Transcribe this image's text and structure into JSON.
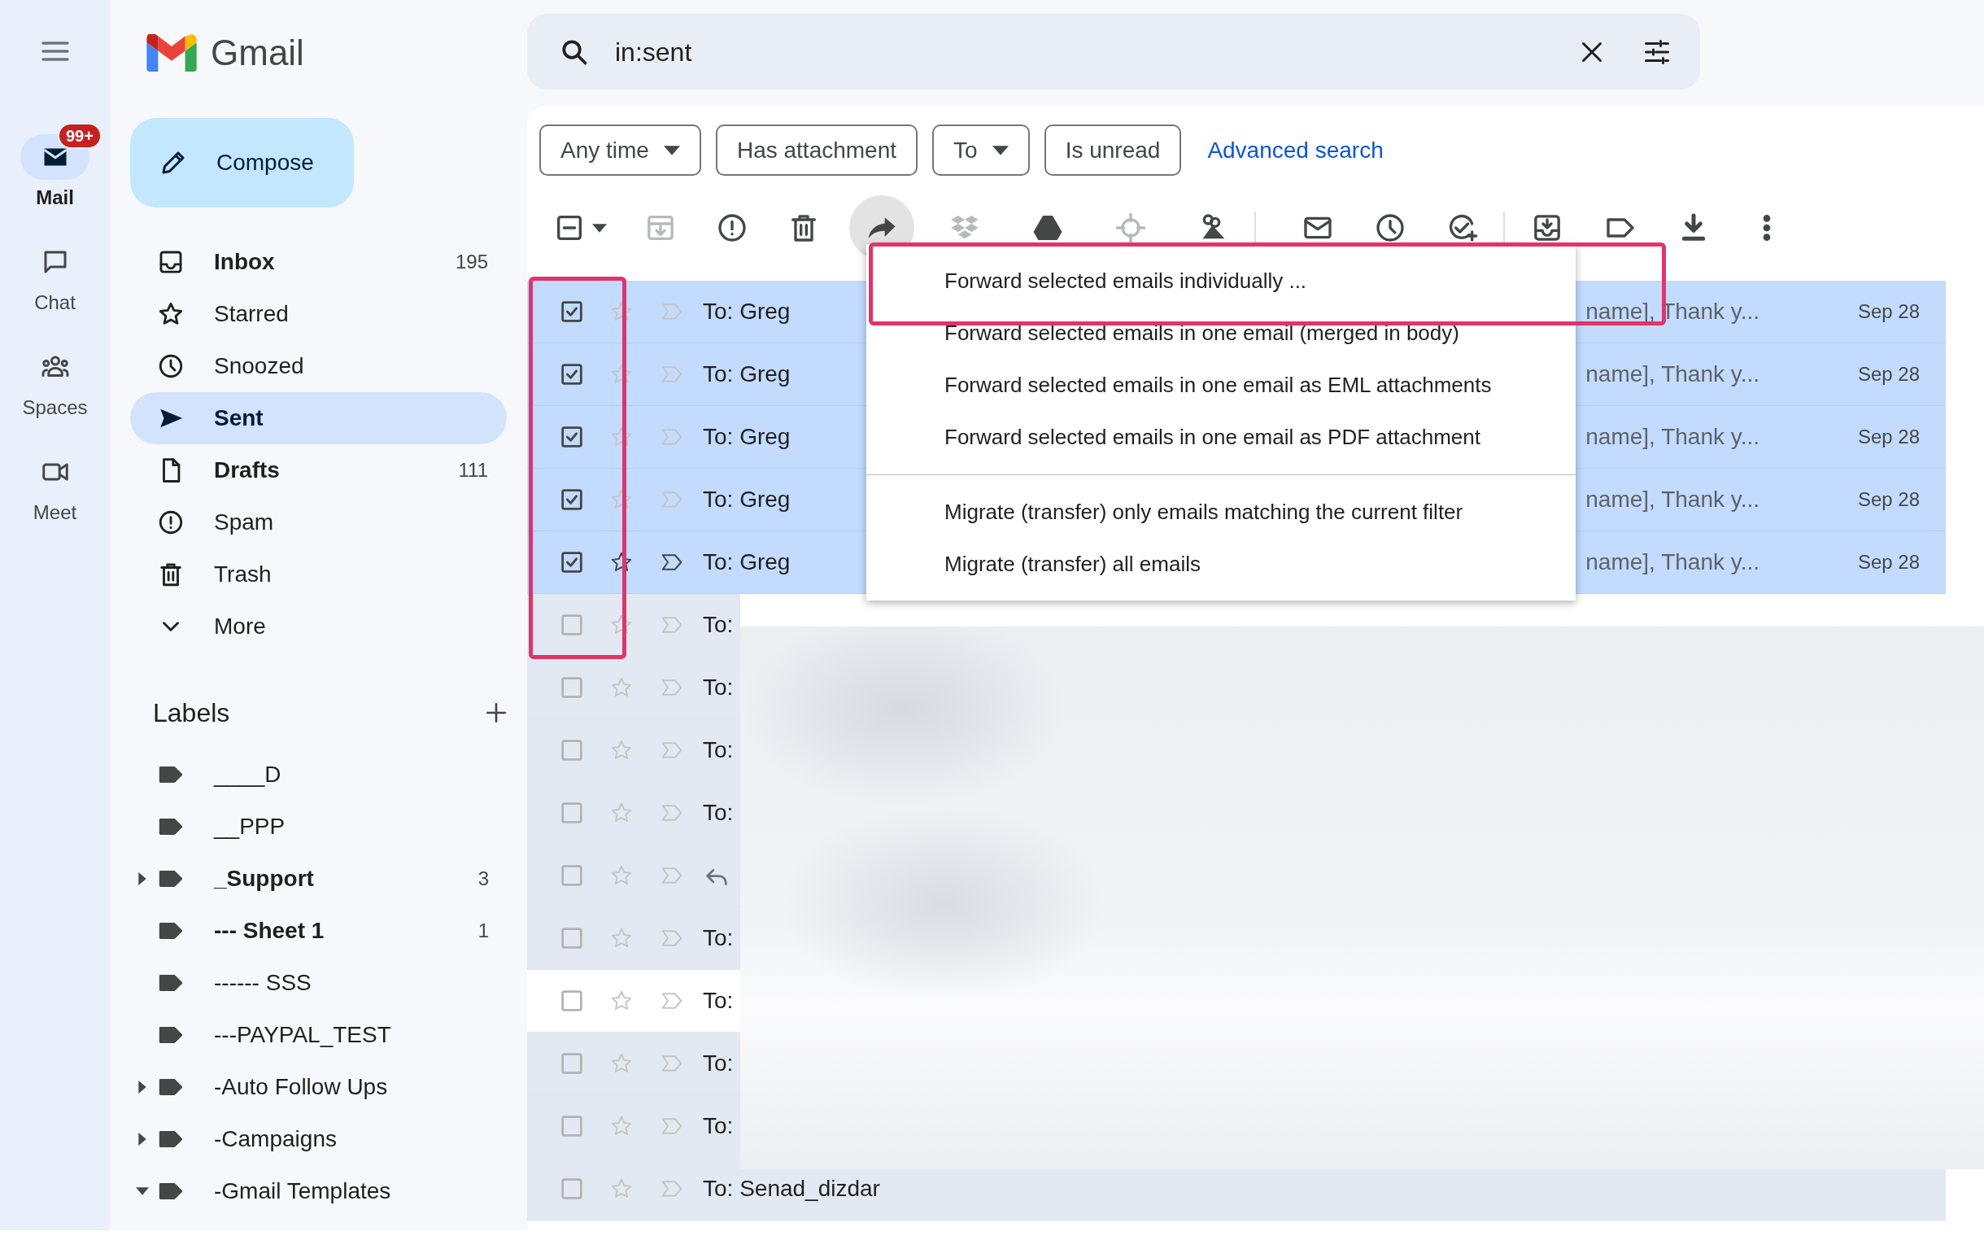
{
  "rail": {
    "items": [
      {
        "label": "Mail",
        "selected": true,
        "badge": "99+"
      },
      {
        "label": "Chat",
        "selected": false
      },
      {
        "label": "Spaces",
        "selected": false
      },
      {
        "label": "Meet",
        "selected": false
      }
    ]
  },
  "brand": {
    "name": "Gmail"
  },
  "compose": {
    "label": "Compose"
  },
  "nav": [
    {
      "label": "Inbox",
      "count": "195",
      "bold": true,
      "selected": false
    },
    {
      "label": "Starred",
      "bold": false,
      "selected": false
    },
    {
      "label": "Snoozed",
      "bold": false,
      "selected": false
    },
    {
      "label": "Sent",
      "bold": true,
      "selected": true
    },
    {
      "label": "Drafts",
      "count": "111",
      "bold": true,
      "selected": false
    },
    {
      "label": "Spam",
      "bold": false,
      "selected": false
    },
    {
      "label": "Trash",
      "bold": false,
      "selected": false
    },
    {
      "label": "More",
      "bold": false,
      "selected": false
    }
  ],
  "labels": {
    "title": "Labels",
    "items": [
      {
        "label": "____D",
        "bold": false
      },
      {
        "label": "__PPP",
        "bold": false
      },
      {
        "label": "_Support",
        "bold": true,
        "count": "3",
        "expanded": false
      },
      {
        "label": "--- Sheet 1",
        "bold": true,
        "count": "1"
      },
      {
        "label": "------ SSS",
        "bold": false
      },
      {
        "label": "---PAYPAL_TEST",
        "bold": false
      },
      {
        "label": "-Auto Follow Ups",
        "bold": false,
        "expanded": false
      },
      {
        "label": "-Campaigns",
        "bold": false,
        "expanded": false
      },
      {
        "label": "-Gmail Templates",
        "bold": false,
        "expanded": true
      }
    ]
  },
  "search": {
    "value": "in:sent"
  },
  "filters": {
    "chips": [
      {
        "label": "Any time",
        "dropdown": true
      },
      {
        "label": "Has attachment",
        "dropdown": false
      },
      {
        "label": "To",
        "dropdown": true
      },
      {
        "label": "Is unread",
        "dropdown": false
      }
    ],
    "link": "Advanced search"
  },
  "forward_menu": {
    "open": true,
    "groups": [
      [
        {
          "label": "Forward selected emails individually ...",
          "outlined": true
        },
        {
          "label": "Forward selected emails in one email (merged in body)",
          "outlined": false
        },
        {
          "label": "Forward selected emails in one email as EML attachments",
          "outlined": false
        },
        {
          "label": "Forward selected emails in one email as PDF attachment",
          "outlined": false
        }
      ],
      [
        {
          "label": "Migrate (transfer) only emails matching the current filter",
          "outlined": false
        },
        {
          "label": "Migrate (transfer) all emails",
          "outlined": false
        }
      ]
    ]
  },
  "emails": [
    {
      "kind": "to",
      "recipient": "To: Greg",
      "snippet": "name], Thank y...",
      "date": "Sep 28",
      "selected": true,
      "checked": true,
      "hovered": false,
      "unread": false,
      "outlined": true,
      "redacted": false
    },
    {
      "kind": "to",
      "recipient": "To: Greg",
      "snippet": "name], Thank y...",
      "date": "Sep 28",
      "selected": true,
      "checked": true,
      "hovered": false,
      "unread": false,
      "outlined": true,
      "redacted": false
    },
    {
      "kind": "to",
      "recipient": "To: Greg",
      "snippet": "name], Thank y...",
      "date": "Sep 28",
      "selected": true,
      "checked": true,
      "hovered": false,
      "unread": false,
      "outlined": true,
      "redacted": false
    },
    {
      "kind": "to",
      "recipient": "To: Greg",
      "snippet": "name], Thank y...",
      "date": "Sep 28",
      "selected": true,
      "checked": true,
      "hovered": false,
      "unread": false,
      "outlined": true,
      "redacted": false
    },
    {
      "kind": "to",
      "recipient": "To: Greg",
      "snippet": "name], Thank y...",
      "date": "Sep 28",
      "selected": true,
      "checked": true,
      "hovered": true,
      "unread": false,
      "outlined": true,
      "redacted": false
    },
    {
      "kind": "to",
      "recipient": "To:",
      "selected": false,
      "checked": false,
      "hovered": false,
      "unread": false,
      "outlined": true,
      "redacted": true
    },
    {
      "kind": "to",
      "recipient": "To:",
      "selected": false,
      "checked": false,
      "hovered": false,
      "unread": false,
      "outlined": false,
      "redacted": true
    },
    {
      "kind": "to",
      "recipient": "To:",
      "selected": false,
      "checked": false,
      "hovered": false,
      "unread": false,
      "outlined": false,
      "redacted": true
    },
    {
      "kind": "to",
      "recipient": "To:",
      "selected": false,
      "checked": false,
      "hovered": false,
      "unread": false,
      "outlined": false,
      "redacted": true
    },
    {
      "kind": "reply",
      "selected": false,
      "checked": false,
      "hovered": false,
      "unread": false,
      "outlined": false,
      "redacted": true
    },
    {
      "kind": "to",
      "recipient": "To:",
      "selected": false,
      "checked": false,
      "hovered": false,
      "unread": false,
      "outlined": false,
      "redacted": true
    },
    {
      "kind": "to",
      "recipient": "To:",
      "selected": false,
      "checked": false,
      "hovered": false,
      "unread": true,
      "outlined": false,
      "redacted": true
    },
    {
      "kind": "to",
      "recipient": "To:",
      "selected": false,
      "checked": false,
      "hovered": false,
      "unread": false,
      "outlined": false,
      "redacted": true
    },
    {
      "kind": "to",
      "recipient": "To:",
      "selected": false,
      "checked": false,
      "hovered": false,
      "unread": false,
      "outlined": false,
      "redacted": true
    },
    {
      "kind": "to",
      "recipient": "To: Senad_dizdar",
      "selected": false,
      "checked": false,
      "hovered": false,
      "unread": false,
      "outlined": false,
      "redacted": false
    }
  ]
}
